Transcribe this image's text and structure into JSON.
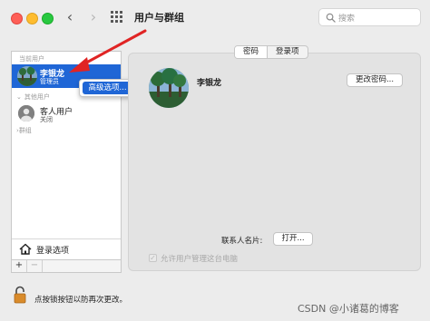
{
  "window": {
    "title": "用户与群组"
  },
  "search": {
    "placeholder": "搜索"
  },
  "sidebar": {
    "current_users_label": "当前用户",
    "current_user": {
      "name": "李银龙",
      "role": "管理员"
    },
    "other_users_label": "其他用户",
    "guest": {
      "name": "客人用户",
      "state": "关闭"
    },
    "groups_label": "群组",
    "login_options_label": "登录选项",
    "add_symbol": "+",
    "remove_symbol": "−"
  },
  "context_menu": {
    "item": "高级选项..."
  },
  "tabs": [
    {
      "label": "密码",
      "active": true
    },
    {
      "label": "登录项",
      "active": false
    }
  ],
  "profile": {
    "name": "李银龙",
    "change_password_label": "更改密码...",
    "contact_card_label": "联系人名片:",
    "open_label": "打开...",
    "allow_admin_label": "允许用户管理这台电脑",
    "allow_admin_checked": true
  },
  "footer": {
    "lock_text": "点按锁按钮以防再次更改。",
    "watermark": "CSDN @小诸葛的博客"
  },
  "colors": {
    "selection": "#1f66d6",
    "arrow": "#e02424"
  }
}
